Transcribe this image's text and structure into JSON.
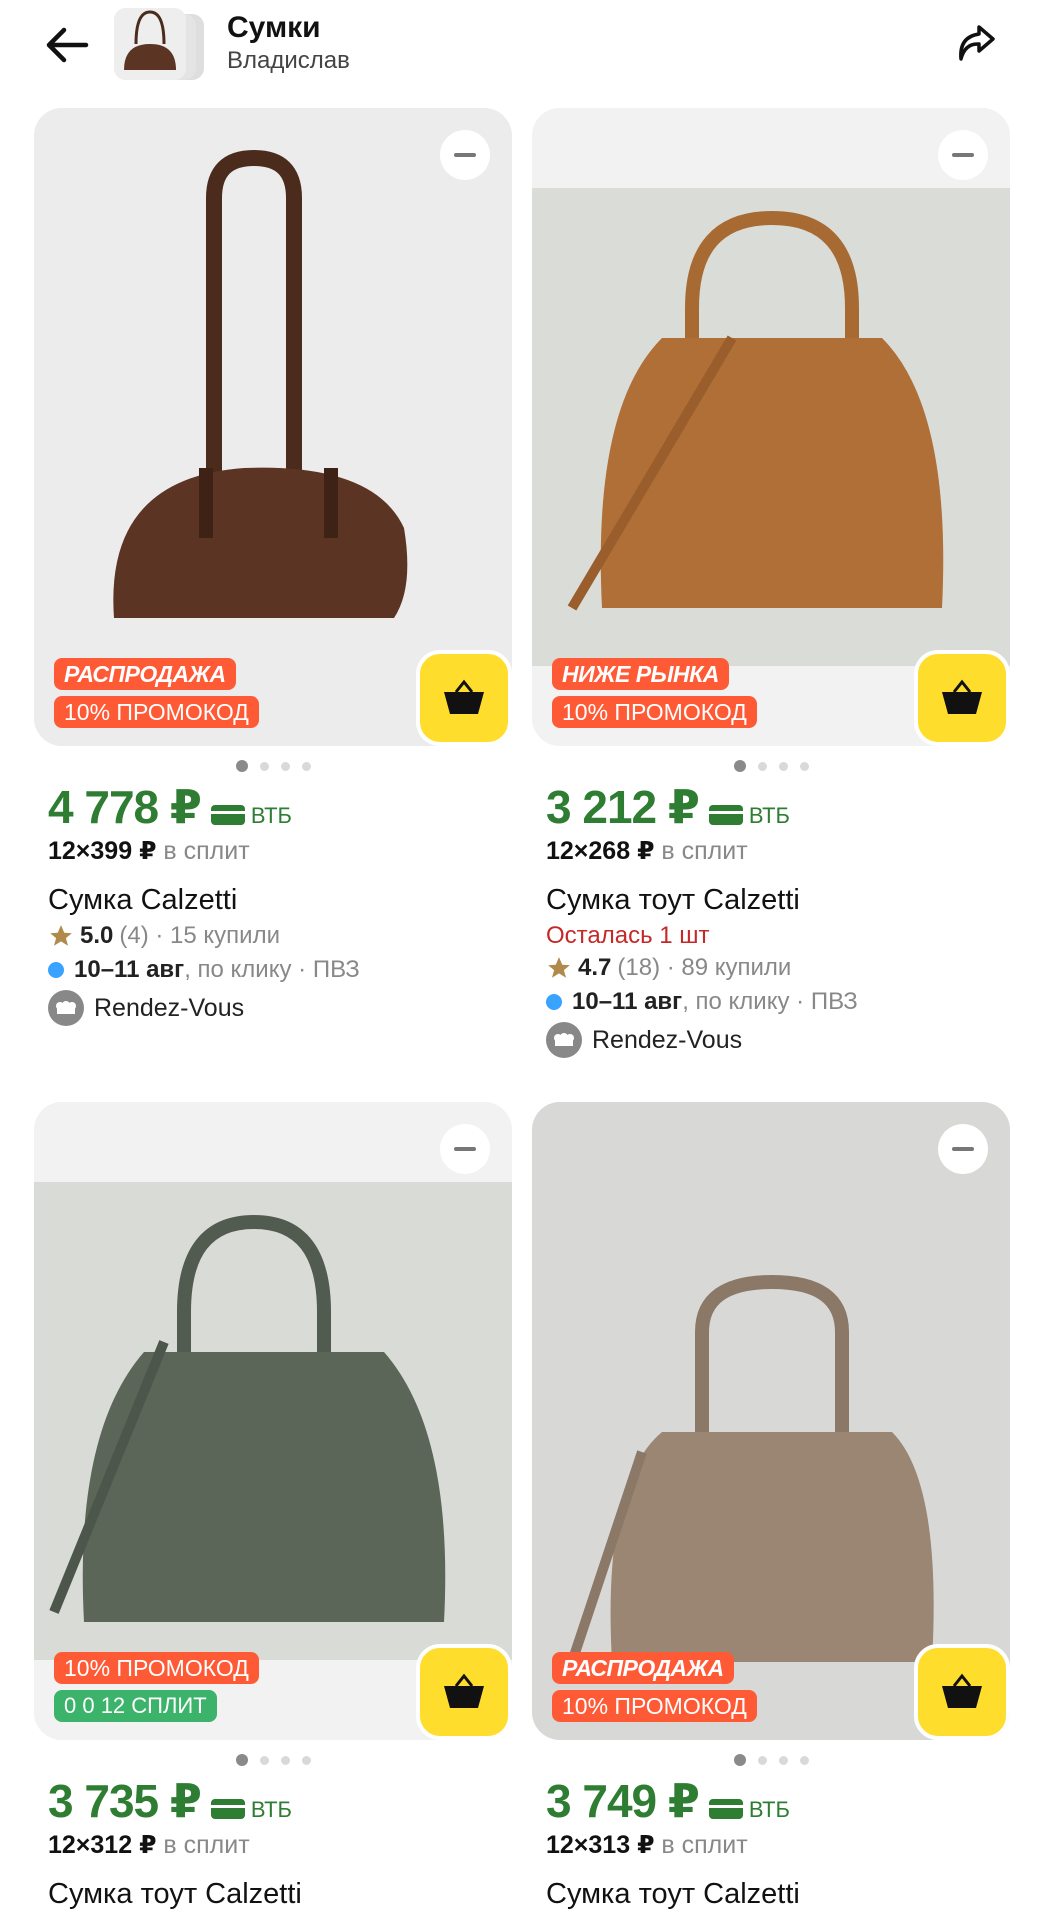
{
  "header": {
    "title": "Сумки",
    "subtitle": "Владислав"
  },
  "products": [
    {
      "badge_top": "РАСПРОДАЖА",
      "promo": "10% ПРОМОКОД",
      "price": "4 778 ₽",
      "bank": "ВТБ",
      "split_amount": "12×399 ₽",
      "split_text": "в сплит",
      "name": "Сумка Calzetti",
      "stock": "",
      "rating": "5.0",
      "reviews": "(4) · 15 купили",
      "delivery_date": "10–11 авг",
      "delivery_rest": ", по клику · ПВЗ",
      "shop": "Rendez-Vous",
      "bag_color": "#5b3423"
    },
    {
      "badge_top": "НИЖЕ РЫНКА",
      "promo": "10% ПРОМОКОД",
      "price": "3 212 ₽",
      "bank": "ВТБ",
      "split_amount": "12×268 ₽",
      "split_text": "в сплит",
      "name": "Сумка тоут Calzetti",
      "stock": "Осталась 1 шт",
      "rating": "4.7",
      "reviews": "(18) · 89 купили",
      "delivery_date": "10–11 авг",
      "delivery_rest": ", по клику · ПВЗ",
      "shop": "Rendez-Vous",
      "bag_color": "#b06f36"
    },
    {
      "badge_top": "",
      "promo": "10% ПРОМОКОД",
      "split_badge": "0 0 12 СПЛИТ",
      "price": "3 735 ₽",
      "bank": "ВТБ",
      "split_amount": "12×312 ₽",
      "split_text": "в сплит",
      "name": "Сумка тоут Calzetti",
      "bag_color": "#5c6658"
    },
    {
      "badge_top": "РАСПРОДАЖА",
      "promo": "10% ПРОМОКОД",
      "price": "3 749 ₽",
      "bank": "ВТБ",
      "split_amount": "12×313 ₽",
      "split_text": "в сплит",
      "name": "Сумка тоут Calzetti",
      "bag_color": "#9a8673"
    }
  ],
  "colors": {
    "accent_green": "#2e7d32",
    "cart_yellow": "#ffdd2d",
    "badge_red": "#ff5a36",
    "split_green": "#3bb36a"
  }
}
